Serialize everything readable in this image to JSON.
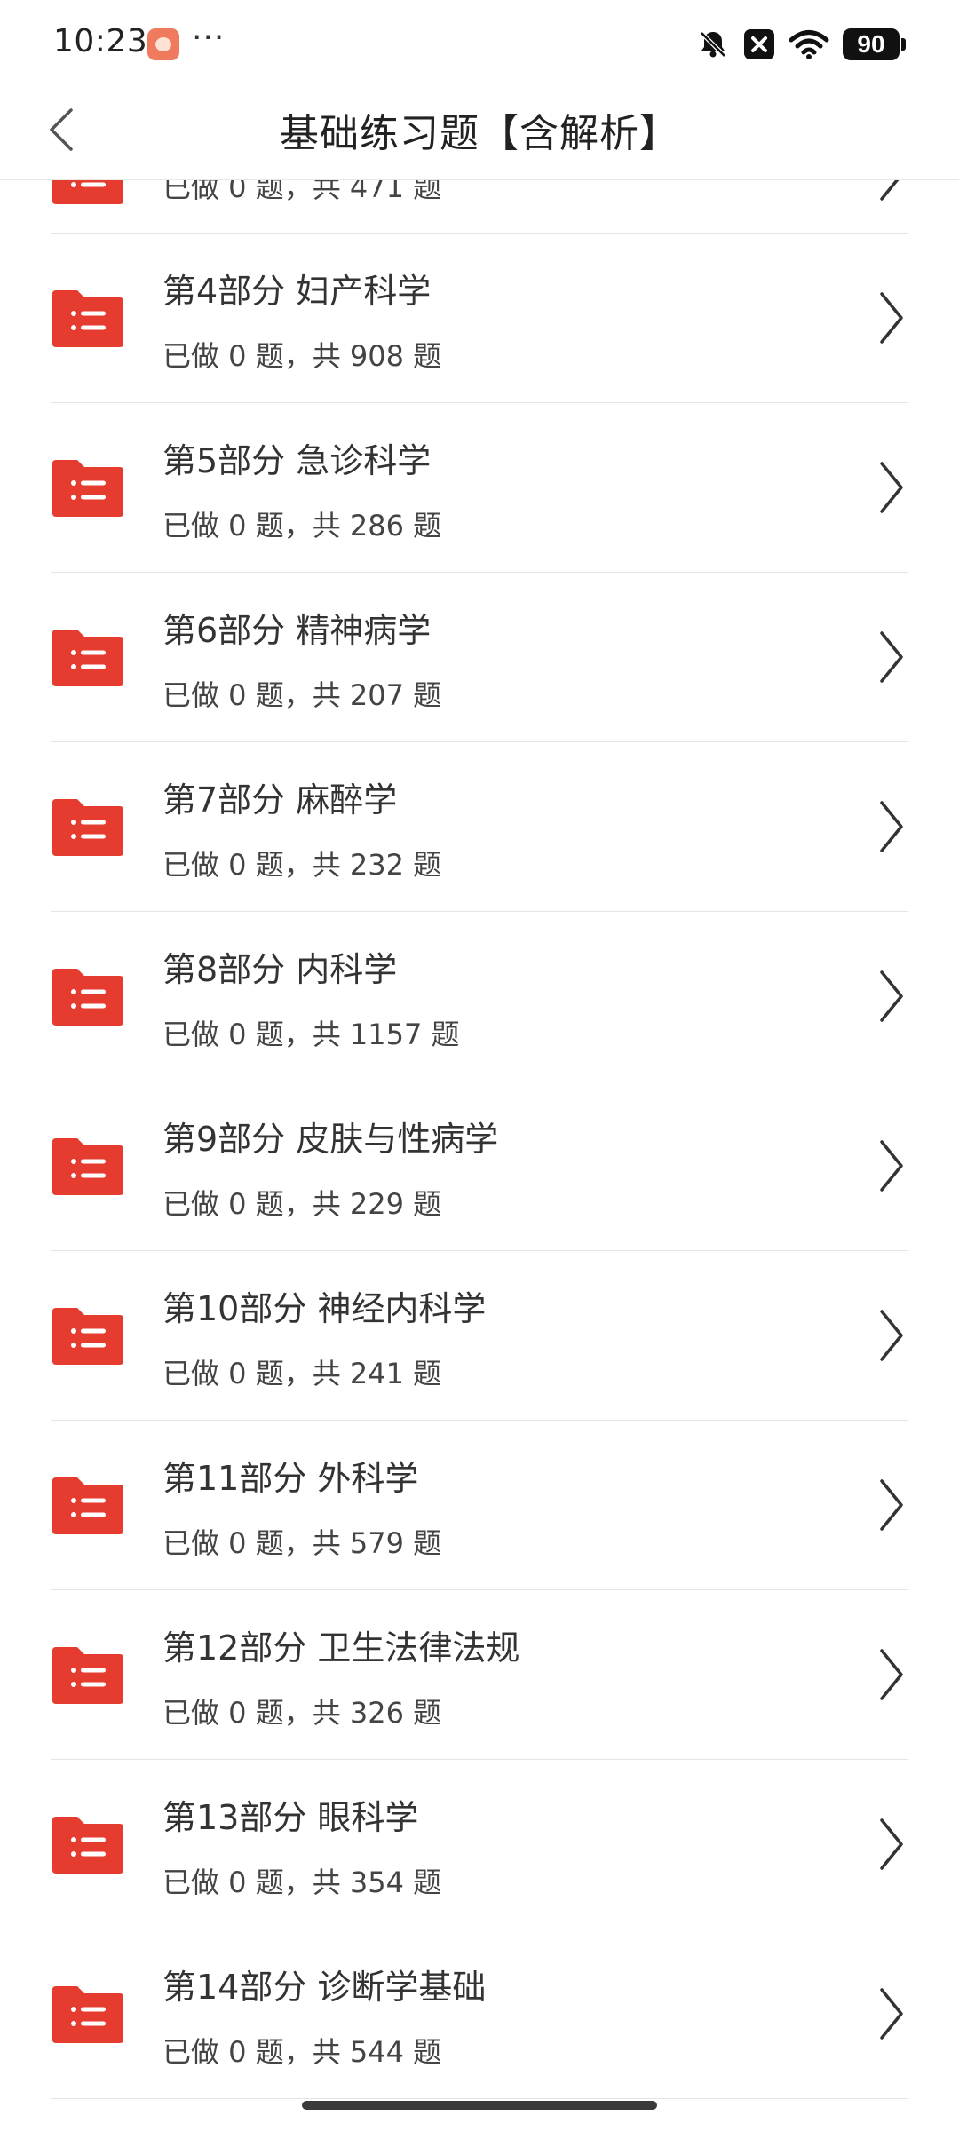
{
  "status_bar": {
    "time": "10:23",
    "dots": "···",
    "battery": "90"
  },
  "header": {
    "title": "基础练习题【含解析】"
  },
  "colors": {
    "accent": "#e53c2f",
    "text_primary": "#333333",
    "divider": "#e5e5e5"
  },
  "list": {
    "items": [
      {
        "title": "",
        "sub": "已做 0 题，共 471 题",
        "icon": "folder-list-icon"
      },
      {
        "title": "第4部分 妇产科学",
        "sub": "已做 0 题，共 908 题",
        "icon": "folder-list-icon"
      },
      {
        "title": "第5部分 急诊科学",
        "sub": "已做 0 题，共 286 题",
        "icon": "folder-list-icon"
      },
      {
        "title": "第6部分 精神病学",
        "sub": "已做 0 题，共 207 题",
        "icon": "folder-list-icon"
      },
      {
        "title": "第7部分 麻醉学",
        "sub": "已做 0 题，共 232 题",
        "icon": "folder-list-icon"
      },
      {
        "title": "第8部分 内科学",
        "sub": "已做 0 题，共 1157 题",
        "icon": "folder-list-icon"
      },
      {
        "title": "第9部分 皮肤与性病学",
        "sub": "已做 0 题，共 229 题",
        "icon": "folder-list-icon"
      },
      {
        "title": "第10部分 神经内科学",
        "sub": "已做 0 题，共 241 题",
        "icon": "folder-list-icon"
      },
      {
        "title": "第11部分 外科学",
        "sub": "已做 0 题，共 579 题",
        "icon": "folder-list-icon"
      },
      {
        "title": "第12部分 卫生法律法规",
        "sub": "已做 0 题，共 326 题",
        "icon": "folder-list-icon"
      },
      {
        "title": "第13部分 眼科学",
        "sub": "已做 0 题，共 354 题",
        "icon": "folder-list-icon"
      },
      {
        "title": "第14部分 诊断学基础",
        "sub": "已做 0 题，共 544 题",
        "icon": "folder-list-icon"
      }
    ]
  }
}
